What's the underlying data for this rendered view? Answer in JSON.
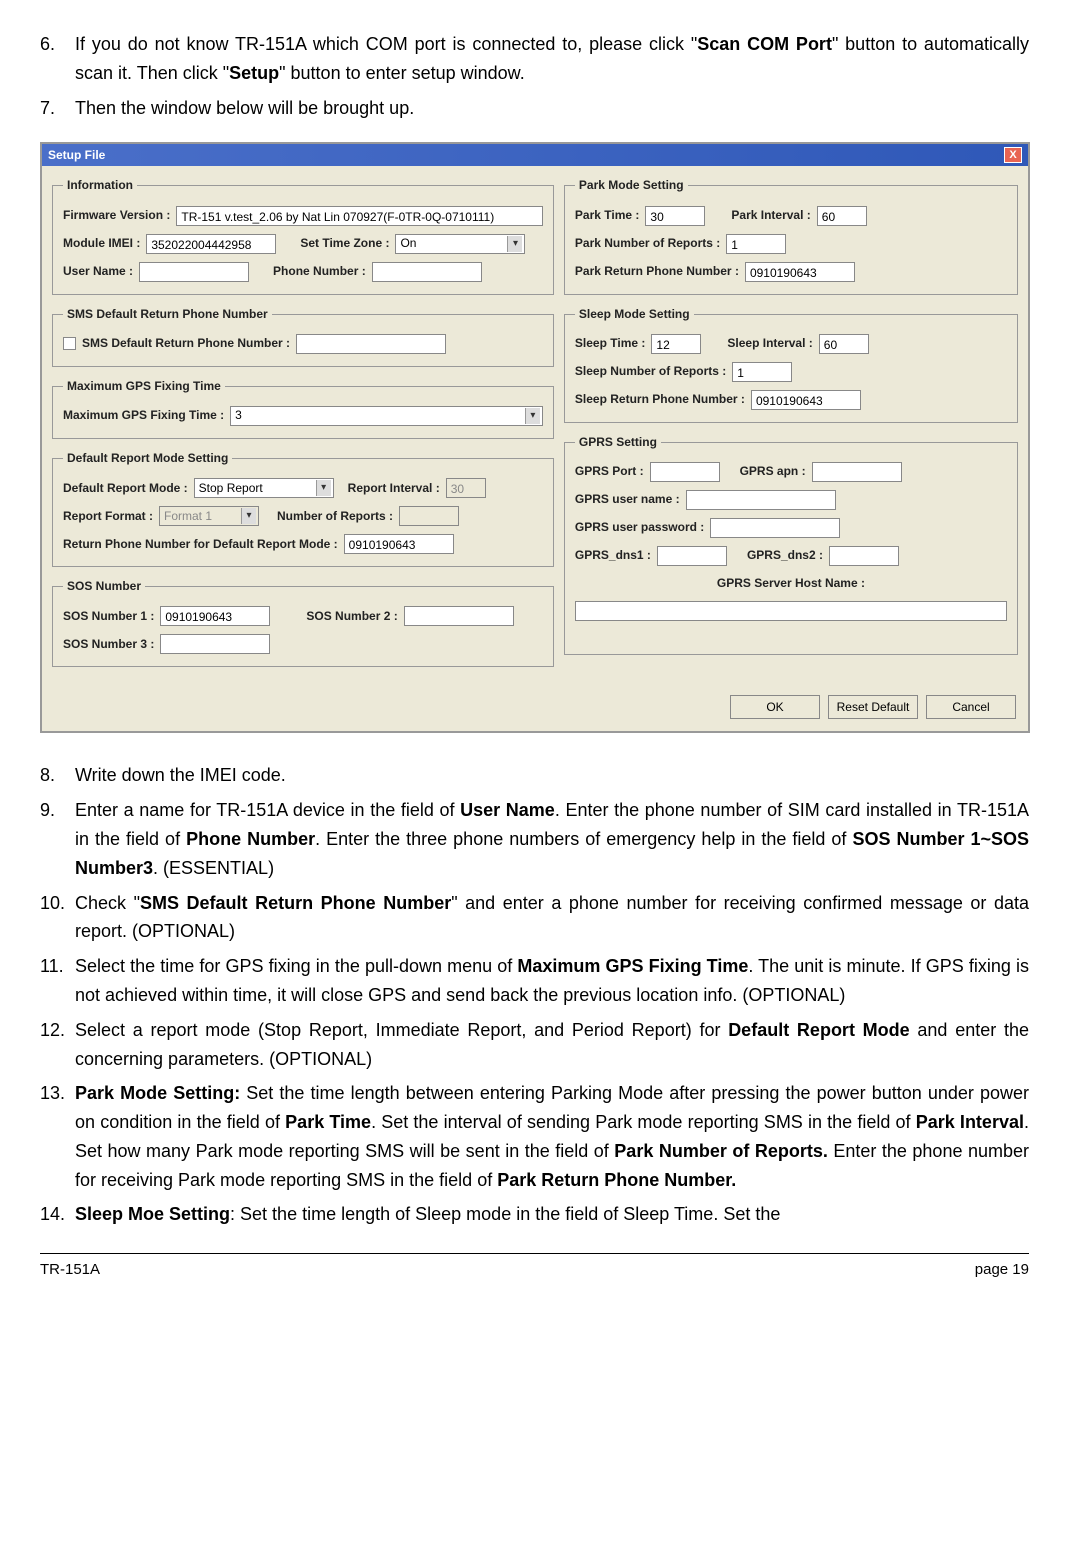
{
  "instructions_top": [
    {
      "num": "6.",
      "parts": [
        "If you do not know TR-151A which COM port is connected to, please click \"",
        {
          "b": "Scan COM Port"
        },
        "\" button to automatically scan it. Then click \"",
        {
          "b": "Setup"
        },
        "\" button to enter setup window."
      ]
    },
    {
      "num": "7.",
      "parts": [
        "Then the window below will be brought up."
      ]
    }
  ],
  "window": {
    "title": "Setup File",
    "close": "X",
    "information": {
      "legend": "Information",
      "firmware_label": "Firmware Version :",
      "firmware_value": "TR-151 v.test_2.06 by Nat Lin 070927(F-0TR-0Q-0710111)",
      "imei_label": "Module IMEI :",
      "imei_value": "352022004442958",
      "tz_label": "Set Time Zone :",
      "tz_value": "On",
      "user_label": "User Name :",
      "user_value": "",
      "phone_label": "Phone Number :",
      "phone_value": ""
    },
    "sms_return": {
      "legend": "SMS Default Return Phone Number",
      "check_label": "SMS Default Return Phone Number :",
      "value": ""
    },
    "gps_fix": {
      "legend": "Maximum GPS Fixing Time",
      "label": "Maximum GPS Fixing Time :",
      "value": "3"
    },
    "report_mode": {
      "legend": "Default Report Mode Setting",
      "mode_label": "Default Report Mode :",
      "mode_value": "Stop Report",
      "interval_label": "Report Interval :",
      "interval_value": "30",
      "format_label": "Report Format :",
      "format_value": "Format 1",
      "num_reports_label": "Number of Reports :",
      "num_reports_value": "",
      "return_label": "Return Phone Number for Default Report Mode :",
      "return_value": "0910190643"
    },
    "sos": {
      "legend": "SOS Number",
      "n1_label": "SOS Number 1 :",
      "n1_value": "0910190643",
      "n2_label": "SOS Number 2 :",
      "n2_value": "",
      "n3_label": "SOS Number 3 :",
      "n3_value": ""
    },
    "park": {
      "legend": "Park Mode Setting",
      "time_label": "Park Time :",
      "time_value": "30",
      "interval_label": "Park Interval :",
      "interval_value": "60",
      "reports_label": "Park Number of Reports :",
      "reports_value": "1",
      "return_label": "Park Return Phone Number  :",
      "return_value": "0910190643"
    },
    "sleep": {
      "legend": "Sleep Mode Setting",
      "time_label": "Sleep Time :",
      "time_value": "12",
      "interval_label": "Sleep Interval :",
      "interval_value": "60",
      "reports_label": "Sleep Number of Reports :",
      "reports_value": "1",
      "return_label": "Sleep Return Phone Number  :",
      "return_value": "0910190643"
    },
    "gprs": {
      "legend": "GPRS Setting",
      "port_label": "GPRS Port :",
      "port_value": "",
      "apn_label": "GPRS apn :",
      "apn_value": "",
      "user_label": "GPRS user name :",
      "user_value": "",
      "pass_label": "GPRS user password :",
      "pass_value": "",
      "dns1_label": "GPRS_dns1 :",
      "dns1_value": "",
      "dns2_label": "GPRS_dns2 :",
      "dns2_value": "",
      "host_label": "GPRS Server Host Name :",
      "host_value": ""
    },
    "buttons": {
      "ok": "OK",
      "reset": "Reset Default",
      "cancel": "Cancel"
    }
  },
  "instructions_bottom": [
    {
      "num": "8.",
      "parts": [
        "Write down the IMEI code."
      ]
    },
    {
      "num": "9.",
      "parts": [
        "Enter a name for TR-151A device in the field of ",
        {
          "b": "User Name"
        },
        ". Enter the phone number of SIM card installed in TR-151A in the field of ",
        {
          "b": "Phone Number"
        },
        ". Enter the three phone numbers of emergency help in the field of ",
        {
          "b": "SOS Number 1~SOS Number3"
        },
        ". (ESSENTIAL)"
      ]
    },
    {
      "num": "10.",
      "parts": [
        "Check \"",
        {
          "b": "SMS Default Return Phone Number"
        },
        "\" and enter a phone number for receiving confirmed message or data report. (OPTIONAL)"
      ]
    },
    {
      "num": "11.",
      "parts": [
        "Select the time for GPS fixing in the pull-down menu of ",
        {
          "b": "Maximum GPS Fixing Time"
        },
        ". The unit is minute. If GPS fixing is not achieved within time, it will close GPS and send back the previous location info. (OPTIONAL)"
      ]
    },
    {
      "num": "12.",
      "parts": [
        "Select a report mode (Stop Report, Immediate Report, and Period Report) for ",
        {
          "b": "Default Report Mode"
        },
        " and enter the concerning parameters. (OPTIONAL)"
      ]
    },
    {
      "num": "13.",
      "parts": [
        {
          "b": "Park Mode Setting:"
        },
        " Set the time length between entering Parking Mode after pressing the power button under power on condition in the field of ",
        {
          "b": "Park Time"
        },
        ". Set the interval of sending Park mode reporting SMS in the field of ",
        {
          "b": "Park Interval"
        },
        ". Set how many Park mode reporting SMS will be sent in the field of ",
        {
          "b": "Park Number of Reports."
        },
        " Enter the phone number for receiving Park mode reporting SMS in the field of ",
        {
          "b": "Park Return Phone Number."
        }
      ]
    },
    {
      "num": "14.",
      "parts": [
        {
          "b": "Sleep Moe Setting"
        },
        ": Set the time length of Sleep mode in the field of Sleep Time. Set the"
      ]
    }
  ],
  "footer": {
    "left": "TR-151A",
    "right": "page 19"
  }
}
